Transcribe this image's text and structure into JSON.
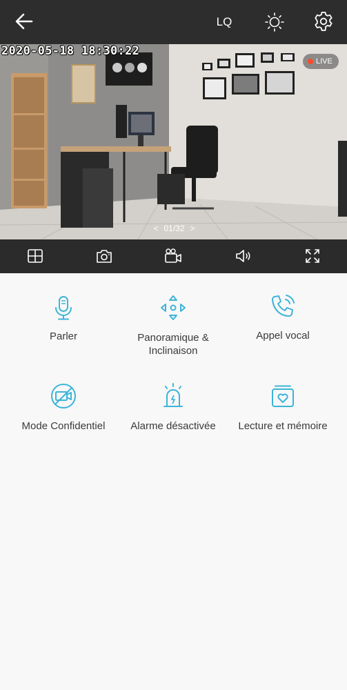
{
  "header": {
    "quality_label": "LQ",
    "icons": [
      "back-arrow-icon",
      "brightness-icon",
      "gear-icon"
    ]
  },
  "video": {
    "timestamp": "2020-05-18 18:30:22",
    "live_label": "LIVE",
    "pager": {
      "prev": "<",
      "current": "01/32",
      "next": ">"
    }
  },
  "controls": {
    "icons": [
      "split-view-icon",
      "camera-snapshot-icon",
      "video-record-icon",
      "speaker-volume-icon",
      "fullscreen-icon"
    ]
  },
  "features": [
    {
      "label": "Parler",
      "icon": "microphone-icon"
    },
    {
      "label": "Panoramique & Inclinaison",
      "icon": "pan-tilt-arrows-icon"
    },
    {
      "label": "Appel vocal",
      "icon": "phone-call-icon"
    },
    {
      "label": "Mode Confidentiel",
      "icon": "camera-off-icon"
    },
    {
      "label": "Alarme désactivée",
      "icon": "siren-alarm-icon"
    },
    {
      "label": "Lecture et mémoire",
      "icon": "playback-heart-icon"
    }
  ],
  "colors": {
    "accent": "#3bb4d9",
    "topbar": "#2d2d2d",
    "live_dot": "#ff4b2b",
    "background": "#f8f8f8"
  }
}
